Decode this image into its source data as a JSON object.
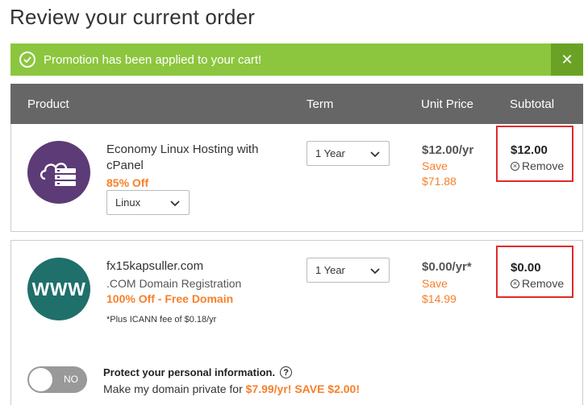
{
  "page_title": "Review your current order",
  "promo": {
    "text": "Promotion has been applied to your cart!",
    "close": "✕"
  },
  "table_header": {
    "product": "Product",
    "term": "Term",
    "unit_price": "Unit Price",
    "subtotal": "Subtotal"
  },
  "items": [
    {
      "logo": "server-cloud-icon",
      "name": "Economy Linux Hosting with cPanel",
      "discount": "85% Off",
      "option": "Linux",
      "term": "1 Year",
      "unit_price": "$12.00/yr",
      "save_label": "Save",
      "save_amount": "$71.88",
      "subtotal": "$12.00",
      "remove": "Remove"
    },
    {
      "logo": "WWW",
      "name": "fx15kapsuller.com",
      "subtitle": ".COM Domain Registration",
      "discount": "100% Off - Free Domain",
      "note": "*Plus ICANN fee of $0.18/yr",
      "term": "1 Year",
      "unit_price": "$0.00/yr*",
      "save_label": "Save",
      "save_amount": "$14.99",
      "subtotal": "$0.00",
      "remove": "Remove"
    }
  ],
  "privacy": {
    "toggle_label": "NO",
    "title": "Protect your personal information.",
    "help": "?",
    "line_prefix": "Make my domain private for ",
    "line_offer": "$7.99/yr! SAVE $2.00!"
  },
  "colors": {
    "promo_green": "#8cc63e",
    "header_gray": "#666666",
    "accent_orange": "#f7802b",
    "highlight_red": "#e02a2a"
  }
}
